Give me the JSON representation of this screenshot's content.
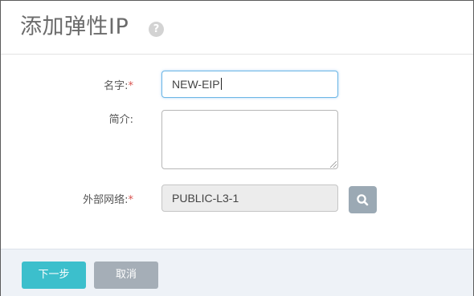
{
  "dialog": {
    "title": "添加弹性IP",
    "help_icon": "question-mark-icon"
  },
  "form": {
    "name": {
      "label": "名字:",
      "required_mark": "*",
      "value": "NEW-EIP"
    },
    "description": {
      "label": "简介:",
      "value": ""
    },
    "external_network": {
      "label": "外部网络:",
      "required_mark": "*",
      "value": "PUBLIC-L3-1",
      "search_icon": "search-icon"
    }
  },
  "footer": {
    "next_label": "下一步",
    "cancel_label": "取消"
  },
  "colors": {
    "primary": "#3cbfcc",
    "required": "#d9534f",
    "search_button": "#9ba9b4",
    "footer_bg": "#eef2f7"
  }
}
